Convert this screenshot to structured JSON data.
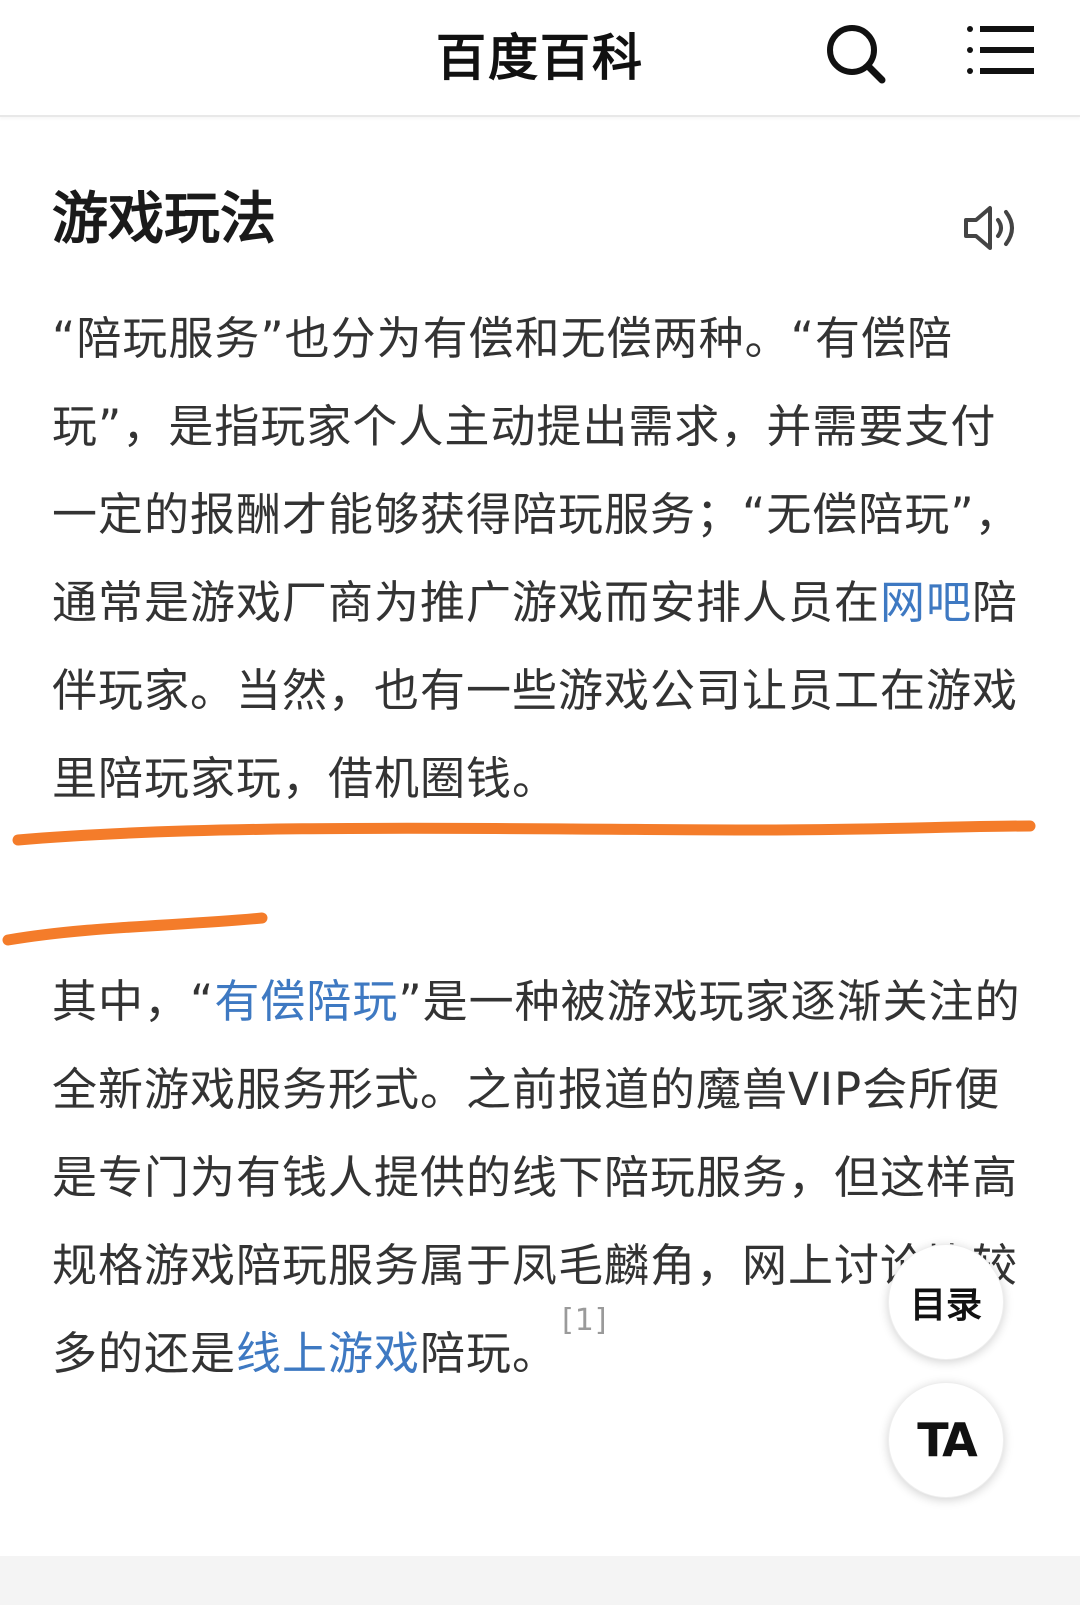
{
  "header": {
    "brand": "百度百科",
    "search_icon": "search-icon",
    "menu_icon": "menu-icon"
  },
  "section": {
    "title": "游戏玩法",
    "speaker_icon": "speaker-icon"
  },
  "paragraph1": {
    "text_a": "“陪玩服务”也分为有偿和无偿两种。“有偿陪玩”，是指玩家个人主动提出需求，并需要支付一定的报酬才能够获得陪玩服务；“无偿陪玩”，通常是游戏厂商为推广游戏而安排人员在",
    "link": "网吧",
    "text_b": "陪伴玩家。当然，也有一些游戏公司让员工在游戏里陪玩家玩，借机圈钱。"
  },
  "paragraph2": {
    "text_a": "其中，“",
    "link1": "有偿陪玩",
    "text_b": "”是一种被游戏玩家逐渐关注的全新游戏服务形式。之前报道的魔兽VIP会所便是专门为有钱人提供的线下陪玩服务，但这样高规格游戏陪玩服务属于凤毛麟角，网上讨论比较多的还是",
    "link2": "线上游戏",
    "text_c": "陪玩。",
    "citation": "[1]"
  },
  "floating": {
    "toc_label": "目录",
    "ta_label": "TA"
  },
  "colors": {
    "link": "#3e79c2",
    "annotation": "#f47c2a",
    "text": "#333333"
  }
}
